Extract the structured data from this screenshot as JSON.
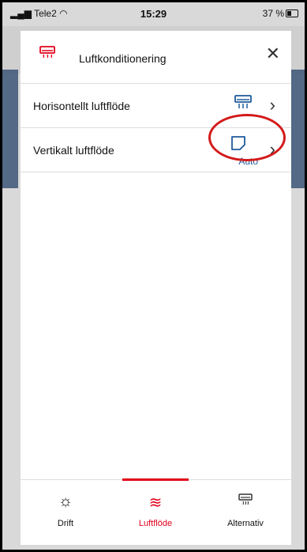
{
  "status_bar": {
    "carrier": "Tele2",
    "time": "15:29",
    "battery": "37 %"
  },
  "modal": {
    "title": "Luftkonditionering",
    "rows": [
      {
        "label": "Horisontellt luftflöde",
        "icon": "ac-unit-icon"
      },
      {
        "label": "Vertikalt luftflöde",
        "icon": "auto-mode-icon",
        "value": "Auto"
      }
    ]
  },
  "nav": {
    "items": [
      {
        "label": "Drift",
        "icon": "sun-icon"
      },
      {
        "label": "Luftflöde",
        "icon": "airflow-icon",
        "active": true
      },
      {
        "label": "Alternativ",
        "icon": "ac-unit-icon"
      }
    ]
  },
  "colors": {
    "accent": "#e2001a",
    "blue": "#1e5a9a",
    "annotation": "#d41a1a"
  }
}
